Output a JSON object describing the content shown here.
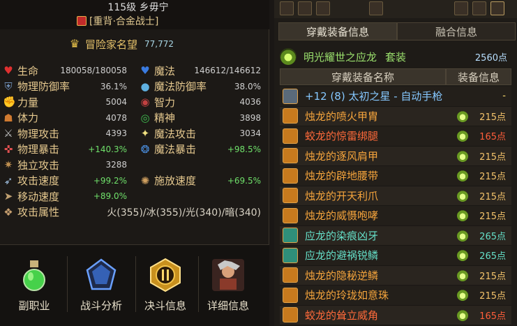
{
  "character": {
    "level_name": "115级 乡毋宁",
    "class_name": "[重背·合金战士]"
  },
  "fame": {
    "label": "冒险家名望",
    "value": "77,772"
  },
  "stats": [
    {
      "left": {
        "icon": "heart-icon",
        "label": "生命",
        "value": "180058/180058",
        "color": "#e03030"
      },
      "right": {
        "icon": "mana-heart-icon",
        "label": "魔法",
        "value": "146612/146612",
        "color": "#3a7be0"
      }
    },
    {
      "left": {
        "icon": "shield-icon",
        "label": "物理防御率",
        "value": "36.1%",
        "color": "#6f8fb8"
      },
      "right": {
        "icon": "orb-icon",
        "label": "魔法防御率",
        "value": "38.0%",
        "color": "#5fb0e0"
      }
    },
    {
      "left": {
        "icon": "strength-icon",
        "label": "力量",
        "value": "5004",
        "color": "#d09040"
      },
      "right": {
        "icon": "intelligence-eye-icon",
        "label": "智力",
        "value": "4036",
        "color": "#c04040"
      }
    },
    {
      "left": {
        "icon": "stamina-icon",
        "label": "体力",
        "value": "4078",
        "color": "#d07a30"
      },
      "right": {
        "icon": "spirit-swirl-icon",
        "label": "精神",
        "value": "3898",
        "color": "#3fbf50"
      }
    },
    {
      "left": {
        "icon": "sword-icon",
        "label": "物理攻击",
        "value": "4393",
        "color": "#c0c0c0"
      },
      "right": {
        "icon": "sparkle-icon",
        "label": "魔法攻击",
        "value": "3034",
        "color": "#f0e080"
      }
    },
    {
      "left": {
        "icon": "crit-target-icon",
        "label": "物理暴击",
        "value": "+140.3%",
        "color": "#e05050"
      },
      "right": {
        "icon": "magic-crit-icon",
        "label": "魔法暴击",
        "value": "+98.5%",
        "color": "#4a8fe0"
      }
    },
    {
      "left": {
        "icon": "independent-attack-icon",
        "label": "独立攻击",
        "value": "3288",
        "color": "#c09050"
      },
      "right": null
    },
    {
      "left": {
        "icon": "attack-speed-icon",
        "label": "攻击速度",
        "value": "+99.2%",
        "color": "#a0c0e0"
      },
      "right": {
        "icon": "cast-speed-icon",
        "label": "施放速度",
        "value": "+69.5%",
        "color": "#d0a060"
      }
    },
    {
      "left": {
        "icon": "move-speed-icon",
        "label": "移动速度",
        "value": "+89.0%",
        "color": "#c0a070"
      },
      "right": null
    }
  ],
  "attribute": {
    "label": "攻击属性",
    "value": "火(355)/冰(355)/光(340)/暗(340)"
  },
  "bottom_buttons": [
    {
      "name": "sub-job-button",
      "label": "副职业",
      "icon": "potion-icon"
    },
    {
      "name": "battle-analysis-button",
      "label": "战斗分析",
      "icon": "crystal-icon"
    },
    {
      "name": "duel-info-button",
      "label": "决斗信息",
      "icon": "duel-badge-icon"
    },
    {
      "name": "detail-info-button",
      "label": "详细信息",
      "icon": "portrait-icon"
    }
  ],
  "tabs": [
    {
      "label": "穿戴装备信息",
      "active": true
    },
    {
      "label": "融合信息",
      "active": false
    }
  ],
  "set": {
    "name": "明光耀世之应龙",
    "type": "套装",
    "points": "2560点"
  },
  "columns": {
    "name": "穿戴装备名称",
    "info": "装备信息"
  },
  "equipment": [
    {
      "name": "+12 (8) 太初之星 - 自动手枪",
      "points": "-",
      "name_color": "c-blue",
      "points_color": "c-gold",
      "gem": false,
      "icon_color": "#5a6a7a"
    },
    {
      "name": "烛龙的喷火甲胄",
      "points": "215点",
      "name_color": "c-orange",
      "points_color": "c-orange",
      "gem": true,
      "icon_color": "#c77a1e"
    },
    {
      "name": "蛟龙的惊雷绑腿",
      "points": "165点",
      "name_color": "c-red",
      "points_color": "c-red",
      "gem": true,
      "icon_color": "#c77a1e"
    },
    {
      "name": "烛龙的逐风肩甲",
      "points": "215点",
      "name_color": "c-orange",
      "points_color": "c-orange",
      "gem": true,
      "icon_color": "#c77a1e"
    },
    {
      "name": "烛龙的辟地腰带",
      "points": "215点",
      "name_color": "c-orange",
      "points_color": "c-orange",
      "gem": true,
      "icon_color": "#c77a1e"
    },
    {
      "name": "烛龙的开天利爪",
      "points": "215点",
      "name_color": "c-orange",
      "points_color": "c-orange",
      "gem": true,
      "icon_color": "#c77a1e"
    },
    {
      "name": "烛龙的威慑咆哮",
      "points": "215点",
      "name_color": "c-orange",
      "points_color": "c-orange",
      "gem": true,
      "icon_color": "#c77a1e"
    },
    {
      "name": "应龙的染痕凶牙",
      "points": "265点",
      "name_color": "c-teal",
      "points_color": "c-teal",
      "gem": true,
      "icon_color": "#2f8f7a"
    },
    {
      "name": "应龙的避祸锐鳞",
      "points": "265点",
      "name_color": "c-teal",
      "points_color": "c-teal",
      "gem": true,
      "icon_color": "#2f8f7a"
    },
    {
      "name": "烛龙的隐秘逆鳞",
      "points": "215点",
      "name_color": "c-orange",
      "points_color": "c-orange",
      "gem": true,
      "icon_color": "#c77a1e"
    },
    {
      "name": "烛龙的玲珑如意珠",
      "points": "215点",
      "name_color": "c-orange",
      "points_color": "c-orange",
      "gem": true,
      "icon_color": "#c77a1e"
    },
    {
      "name": "蛟龙的耸立威角",
      "points": "165点",
      "name_color": "c-red",
      "points_color": "c-red",
      "gem": true,
      "icon_color": "#c77a1e"
    }
  ]
}
